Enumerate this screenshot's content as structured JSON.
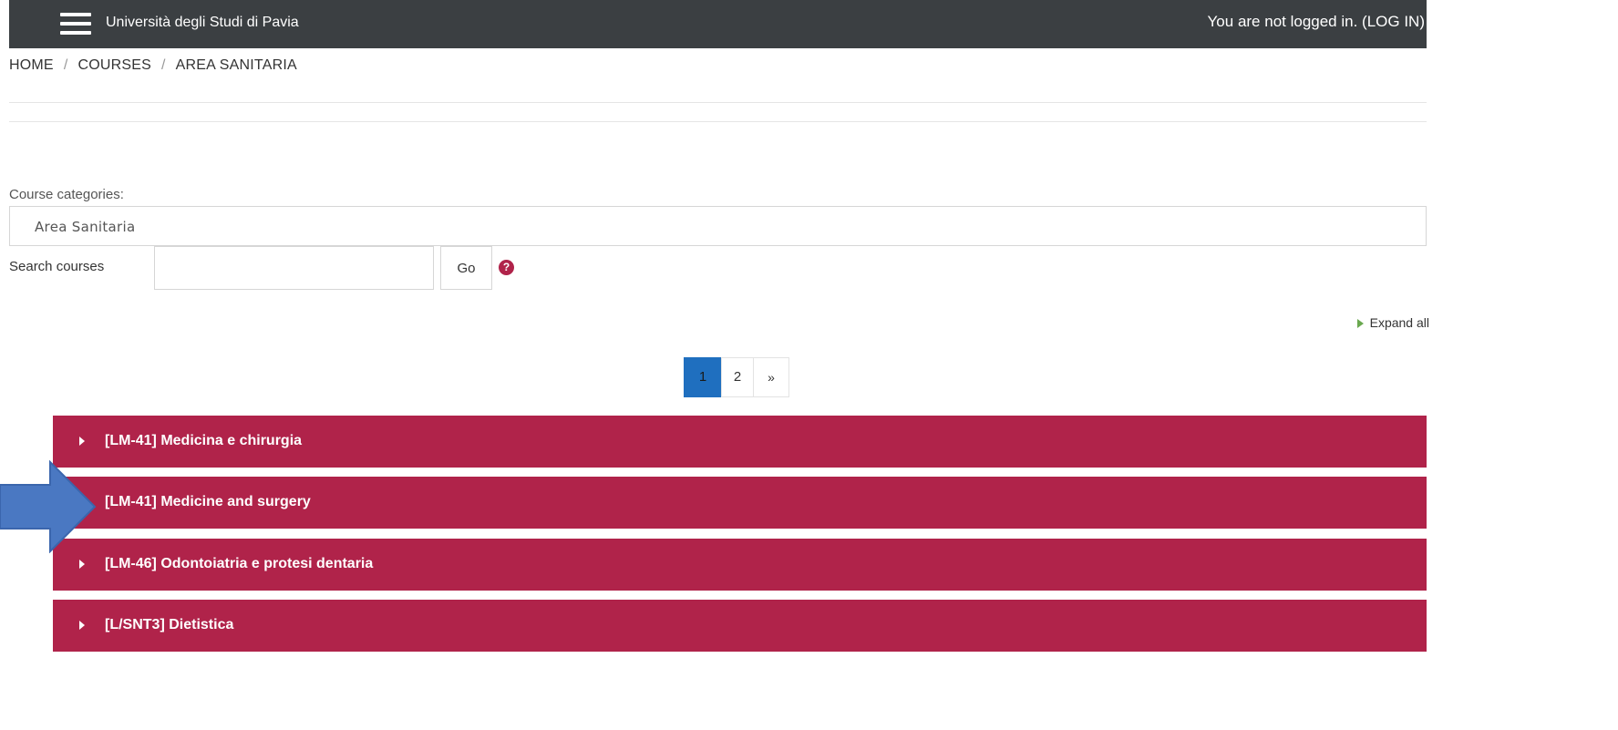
{
  "header": {
    "site_name": "Università degli Studi di Pavia",
    "login_text": "You are not logged in. (",
    "login_link": "LOG IN",
    "login_close": ")"
  },
  "breadcrumb": {
    "items": [
      "HOME",
      "COURSES",
      "AREA SANITARIA"
    ],
    "separator": "/"
  },
  "categories": {
    "label": "Course categories:",
    "selected": "Area Sanitaria"
  },
  "search": {
    "label": "Search courses",
    "value": "",
    "placeholder": "",
    "go_label": "Go",
    "help_symbol": "?"
  },
  "expand_all": {
    "label": "Expand all"
  },
  "pagination": {
    "pages": [
      "1",
      "2"
    ],
    "next": "»",
    "current": "1"
  },
  "courses": [
    {
      "name": "[LM-41] Medicina e chirurgia"
    },
    {
      "name": "[LM-41] Medicine and surgery"
    },
    {
      "name": "[LM-46] Odontoiatria e protesi dentaria"
    },
    {
      "name": "[L/SNT3] Dietistica"
    }
  ],
  "colors": {
    "navbar": "#3b3f42",
    "course_row": "#b0234a",
    "active_page": "#1f6fbf",
    "annotation_arrow": "#4a78c2",
    "expand_icon": "#6aa84f"
  },
  "icons": {
    "menu": "hamburger-icon",
    "help": "question-circle-icon",
    "expand": "triangle-right-icon",
    "caret": "caret-right-icon",
    "annotation": "arrow-right-annotation"
  }
}
